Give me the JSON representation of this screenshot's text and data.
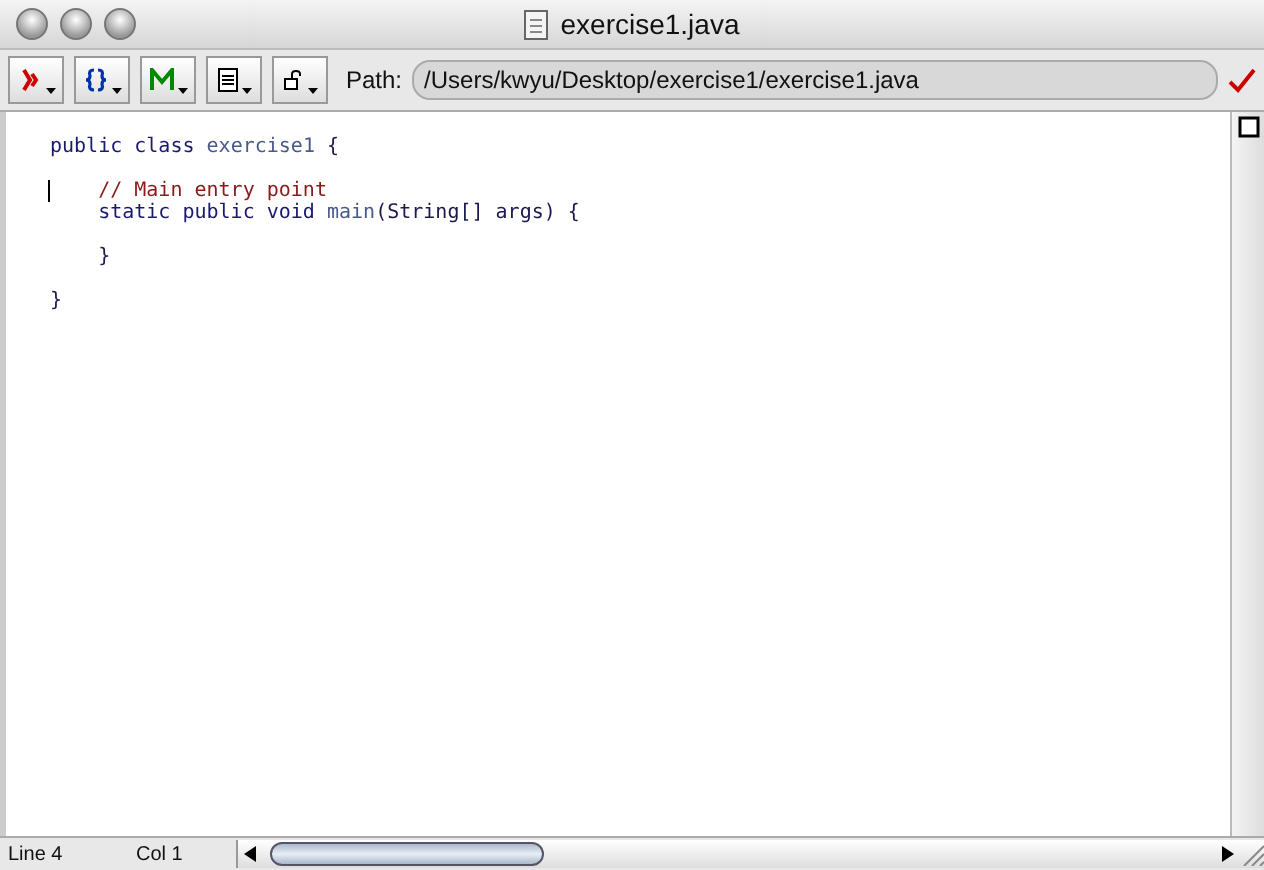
{
  "window": {
    "title": "exercise1.java"
  },
  "toolbar": {
    "buttons": [
      {
        "kind": "compile"
      },
      {
        "kind": "braces"
      },
      {
        "kind": "methods"
      },
      {
        "kind": "document"
      },
      {
        "kind": "lock"
      }
    ],
    "path_label": "Path:",
    "path": "/Users/kwyu/Desktop/exercise1/exercise1.java"
  },
  "code": [
    {
      "caret": false,
      "tokens": [
        {
          "kind": "keyword",
          "text": "public class "
        },
        {
          "kind": "name",
          "text": "exercise1"
        },
        {
          "kind": "plain",
          "text": " {"
        }
      ]
    },
    {
      "caret": false
    },
    {
      "caret": true,
      "tokens": [
        {
          "kind": "comment",
          "text": "    // Main entry point"
        }
      ]
    },
    {
      "caret": false,
      "tokens": [
        {
          "kind": "keyword",
          "text": "    static public void "
        },
        {
          "kind": "name",
          "text": "main"
        },
        {
          "kind": "plain",
          "text": "(String[] args) {"
        }
      ]
    },
    {
      "caret": false
    },
    {
      "caret": false,
      "tokens": [
        {
          "kind": "plain",
          "text": "    }"
        }
      ]
    },
    {
      "caret": false
    },
    {
      "caret": false,
      "tokens": [
        {
          "kind": "plain",
          "text": "}"
        }
      ]
    }
  ],
  "status_bar": {
    "line": "Line 4",
    "column": "Col 1"
  }
}
